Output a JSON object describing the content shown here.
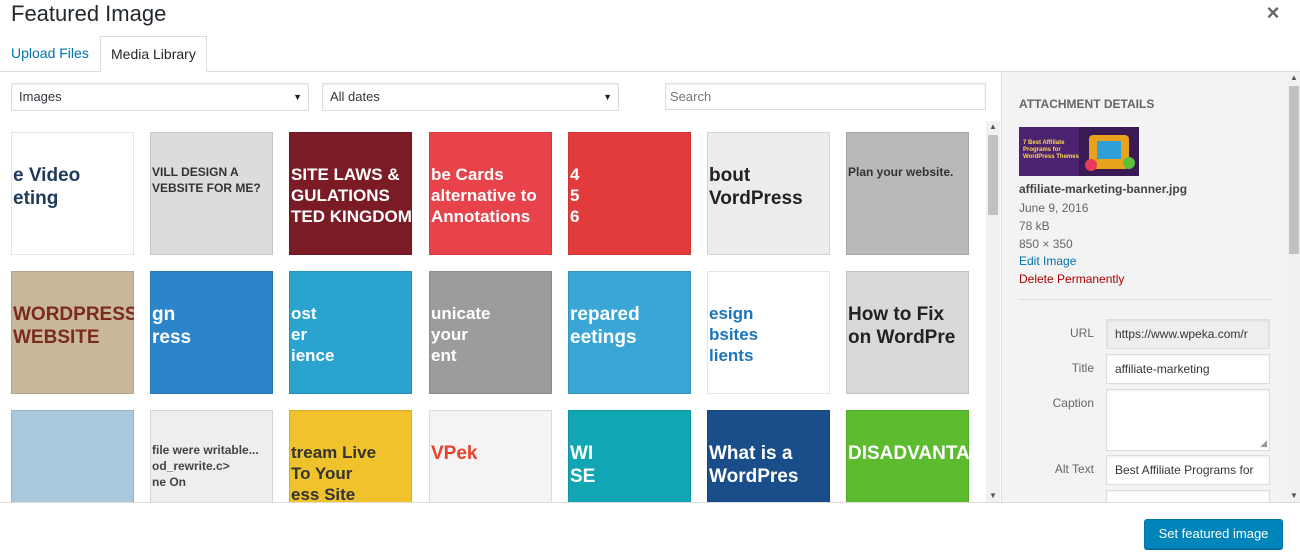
{
  "modal": {
    "title": "Featured Image",
    "close_glyph": "×"
  },
  "tabs": [
    {
      "label": "Upload Files",
      "active": false
    },
    {
      "label": "Media Library",
      "active": true
    }
  ],
  "filters": {
    "type_value": "Images",
    "date_value": "All dates",
    "search_placeholder": "Search"
  },
  "grid": {
    "items": [
      {
        "lines": [
          "e Video",
          "eting"
        ],
        "bg": "#ffffff",
        "fg": "#1f3b5a"
      },
      {
        "lines": [
          "VILL DESIGN A",
          "VEBSITE FOR ME?"
        ],
        "bg": "#dcdcdc",
        "fg": "#333333"
      },
      {
        "lines": [
          "SITE LAWS &",
          "GULATIONS",
          "TED KINGDOM"
        ],
        "bg": "#7b1b26",
        "fg": "#ffffff"
      },
      {
        "lines": [
          "be Cards",
          "alternative to",
          "Annotations"
        ],
        "bg": "#e8424b",
        "fg": "#ffffff"
      },
      {
        "lines": [
          "4",
          "5",
          "6"
        ],
        "bg": "#e23b3b",
        "fg": "#ffffff"
      },
      {
        "lines": [
          "bout",
          "VordPress"
        ],
        "bg": "#ececec",
        "fg": "#222222"
      },
      {
        "lines": [
          "Plan your website."
        ],
        "bg": "#b9b9b9",
        "fg": "#333333"
      },
      {
        "lines": [
          "WORDPRESS",
          "WEBSITE"
        ],
        "bg": "#c8b79a",
        "fg": "#7a2b1b"
      },
      {
        "lines": [
          "gn",
          "ress"
        ],
        "bg": "#2c84c9",
        "fg": "#ffffff"
      },
      {
        "lines": [
          "ost",
          "er",
          "ience"
        ],
        "bg": "#2aa4cf",
        "fg": "#ffffff"
      },
      {
        "lines": [
          "unicate",
          "your",
          "ent"
        ],
        "bg": "#9c9c9c",
        "fg": "#ffffff"
      },
      {
        "lines": [
          "repared",
          "eetings"
        ],
        "bg": "#3aa6d6",
        "fg": "#ffffff"
      },
      {
        "lines": [
          "esign",
          "bsites",
          "lients"
        ],
        "bg": "#ffffff",
        "fg": "#1b75bb"
      },
      {
        "lines": [
          "How to Fix",
          "on WordPre"
        ],
        "bg": "#d9d9d9",
        "fg": "#222222"
      },
      {
        "lines": [
          ""
        ],
        "bg": "#a9c8dc",
        "fg": "#ffffff"
      },
      {
        "lines": [
          "file were writable...",
          "od_rewrite.c>",
          "ne On"
        ],
        "bg": "#eeeeee",
        "fg": "#444444"
      },
      {
        "lines": [
          "tream Live",
          "To Your",
          "ess Site"
        ],
        "bg": "#f0c22b",
        "fg": "#333333"
      },
      {
        "lines": [
          "VPek"
        ],
        "bg": "#f4f4f4",
        "fg": "#e8422f"
      },
      {
        "lines": [
          "WI",
          "SE"
        ],
        "bg": "#11a6b3",
        "fg": "#ffffff"
      },
      {
        "lines": [
          "What is a",
          "WordPres"
        ],
        "bg": "#1a4e8a",
        "fg": "#ffffff"
      },
      {
        "lines": [
          "DISADVANTAGES"
        ],
        "bg": "#5cbb2e",
        "fg": "#ffffff"
      }
    ]
  },
  "sidebar": {
    "heading": "Attachment Details",
    "preview_text": "7 Best Affiliate Programs for WordPress Themes",
    "filename": "affiliate-marketing-banner.jpg",
    "date": "June 9, 2016",
    "size": "78 kB",
    "dimensions": "850 × 350",
    "edit_link": "Edit Image",
    "delete_link": "Delete Permanently",
    "fields": {
      "url_label": "URL",
      "url_value": "https://www.wpeka.com/r",
      "title_label": "Title",
      "title_value": "affiliate-marketing",
      "caption_label": "Caption",
      "caption_value": "",
      "alt_label": "Alt Text",
      "alt_value": "Best Affiliate Programs for"
    }
  },
  "footer": {
    "primary_button": "Set featured image"
  },
  "colors": {
    "link": "#0073aa",
    "delete": "#aa0000",
    "primary": "#0085ba"
  }
}
